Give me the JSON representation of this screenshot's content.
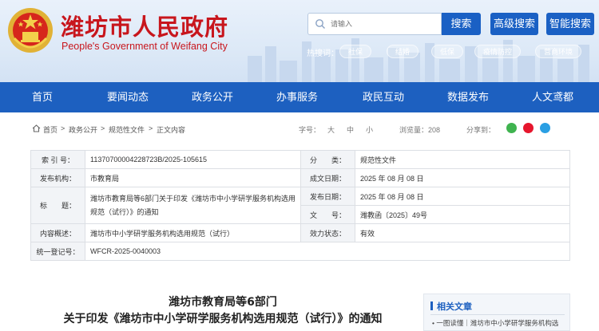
{
  "header": {
    "site_title": "潍坊市人民政府",
    "site_subtitle": "People's Government of Weifang City",
    "search_placeholder": "请输入",
    "search_button": "搜索",
    "advanced_search_button": "高级搜索",
    "smart_search_button": "智能搜索",
    "hot_words_label": "热搜词：",
    "hot_words": [
      "社保",
      "结婚",
      "低保",
      "疫情防控",
      "营商环境"
    ]
  },
  "nav": {
    "items": [
      "首页",
      "要闻动态",
      "政务公开",
      "办事服务",
      "政民互动",
      "数据发布",
      "人文鸢都"
    ]
  },
  "breadcrumb": {
    "items": [
      "首页",
      "政务公开",
      "规范性文件",
      "正文内容"
    ],
    "separator": ">",
    "font_size_label": "字号：",
    "font_sizes": [
      "大",
      "中",
      "小"
    ],
    "views_label": "浏览量：208",
    "share_label": "分享到："
  },
  "info_table": {
    "index_label": "索 引 号：",
    "index_value": "11370700004228723B/2025-105615",
    "category_label": "分　　类：",
    "category_value": "规范性文件",
    "publisher_label": "发布机构：",
    "publisher_value": "市教育局",
    "created_label": "成文日期：",
    "created_value": "2025 年 08 月 08 日",
    "title_label": "标　　题：",
    "title_value": "潍坊市教育局等6部门关于印发《潍坊市中小学研学服务机构选用规范（试行）》的通知",
    "published_label": "发布日期：",
    "published_value": "2025 年 08 月 08 日",
    "docno_label": "文　　号：",
    "docno_value": "潍教函〔2025〕49号",
    "summary_label": "内容概述：",
    "summary_value": "潍坊市中小学研学服务机构选用规范（试行）",
    "validity_label": "效力状态：",
    "validity_value": "有效",
    "code_label": "统一登记号：",
    "code_value": "WFCR-2025-0040003"
  },
  "article": {
    "title_line1": "潍坊市教育局等6部门",
    "title_line2": "关于印发《潍坊市中小学研学服务机构选用规范（试行）》的通知"
  },
  "related": {
    "heading": "相关文章",
    "first_item": "一图读懂｜潍坊市中小学研学服务机构选"
  },
  "colors": {
    "brand_red": "#c8161d",
    "nav_blue": "#1d60c0",
    "button_blue": "#1a60c4"
  }
}
